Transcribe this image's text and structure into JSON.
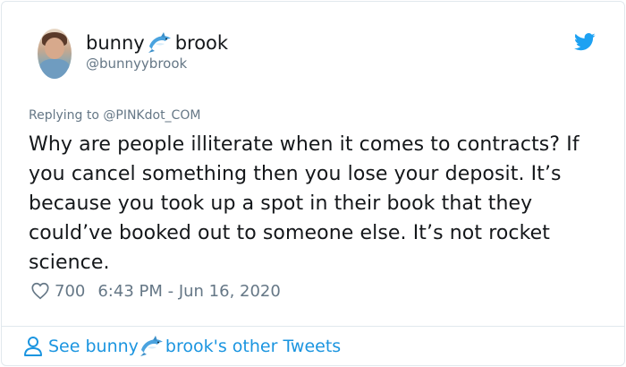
{
  "author": {
    "name_part1": "bunny",
    "name_emoji": "dolphin-emoji",
    "name_part2": "brook",
    "handle": "@bunnyybrook"
  },
  "reply": {
    "prefix": "Replying to ",
    "to": "@PINKdot_COM"
  },
  "tweet": {
    "text": "Why are people illiterate when it comes to contracts? If you cancel something then you lose your deposit. It’s because you took up a spot in their book that they could’ve booked out to someone else. It’s not rocket science."
  },
  "meta": {
    "likes": "700",
    "timestamp": "6:43 PM - Jun 16, 2020"
  },
  "footer": {
    "text_part1": "See bunny",
    "text_part2": "brook's other Tweets"
  },
  "colors": {
    "accent": "#1b95e0",
    "twitter_blue": "#1da1f2",
    "secondary_text": "#657786"
  }
}
